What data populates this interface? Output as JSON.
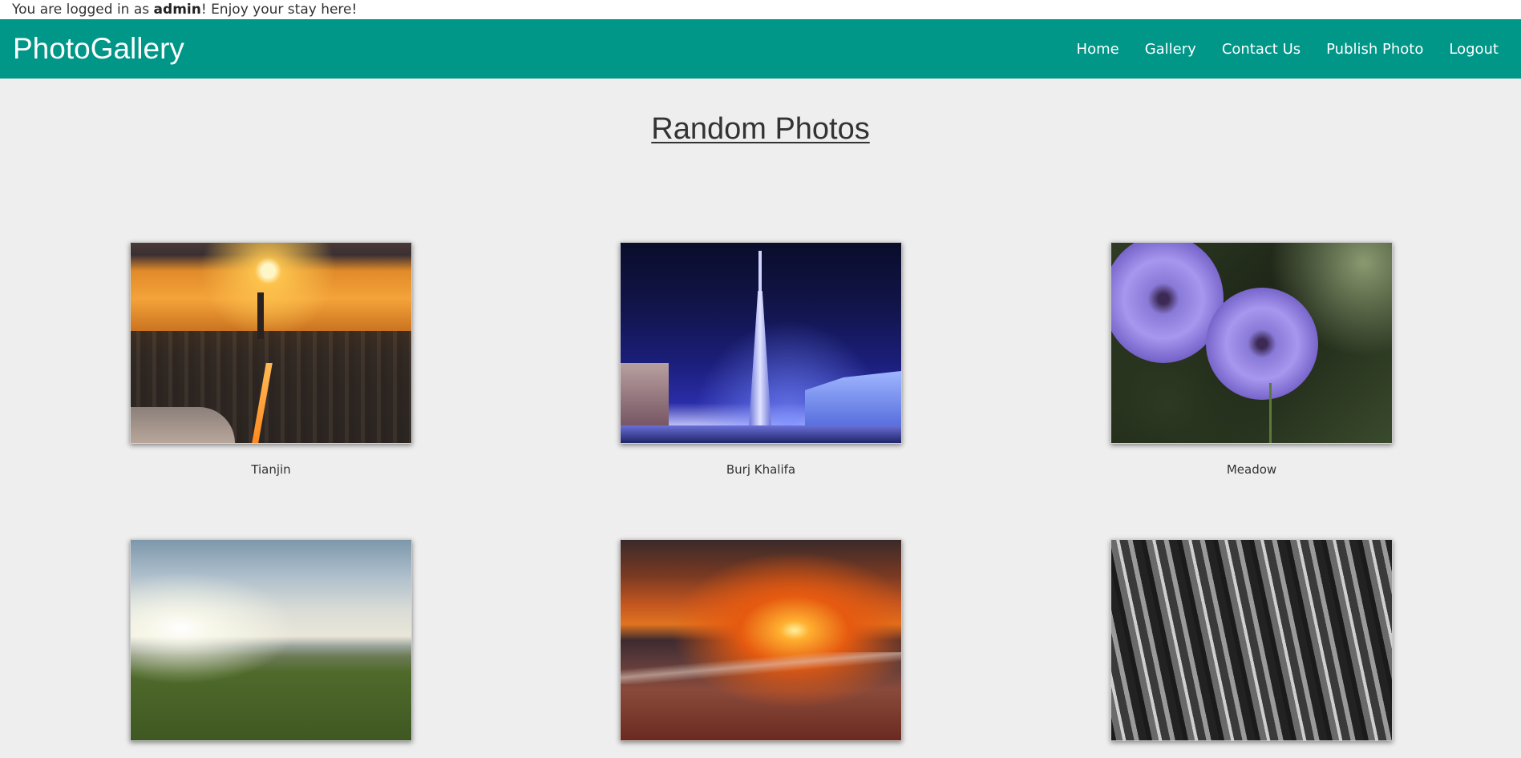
{
  "login_bar": {
    "prefix": "You are logged in as ",
    "username": "admin",
    "suffix": "! Enjoy your stay here!"
  },
  "navbar": {
    "brand": "PhotoGallery",
    "links": [
      "Home",
      "Gallery",
      "Contact Us",
      "Publish Photo",
      "Logout"
    ],
    "color": "#009688"
  },
  "main": {
    "title": "Random Photos",
    "photos": [
      {
        "caption": "Tianjin"
      },
      {
        "caption": "Burj Khalifa"
      },
      {
        "caption": "Meadow"
      },
      {
        "caption": ""
      },
      {
        "caption": ""
      },
      {
        "caption": ""
      }
    ]
  }
}
